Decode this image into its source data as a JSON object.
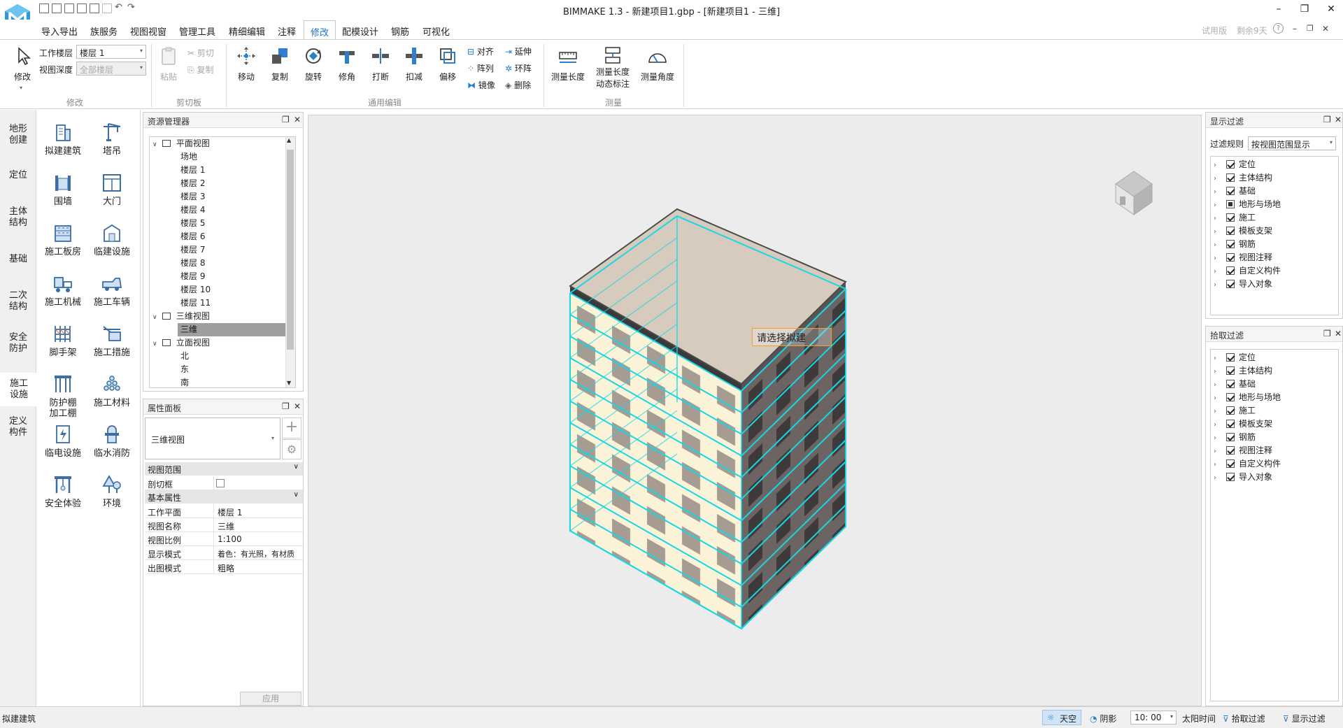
{
  "app": {
    "title": "BIMMAKE 1.3 - 新建项目1.gbp - [新建项目1 - 三维]"
  },
  "colors": {
    "accent": "#1e73c9",
    "selection_cyan": "#19d6e6",
    "panel_bg": "#f0f0f0",
    "viewport_bg": "#ececec"
  },
  "menu": {
    "items": [
      "导入导出",
      "族服务",
      "视图视窗",
      "管理工具",
      "精细编辑",
      "注释",
      "修改",
      "配模设计",
      "钢筋",
      "可视化"
    ],
    "active": "修改",
    "trial": "试用版",
    "remaining": "剩余9天",
    "help": "?"
  },
  "ribbon": {
    "modify": {
      "label": "修改",
      "group": "修改",
      "work_floor_label": "工作楼层",
      "work_floor_value": "楼层 1",
      "view_depth_label": "视图深度",
      "view_depth_value": "全部楼层"
    },
    "clipboard": {
      "group": "剪切板",
      "paste": "粘贴",
      "cut": "剪切",
      "copy": "复制"
    },
    "edit": {
      "group": "通用编辑",
      "move": "移动",
      "copy": "复制",
      "rotate": "旋转",
      "trim": "修角",
      "break": "打断",
      "deduct": "扣减",
      "offset": "偏移",
      "align": "对齐",
      "array": "阵列",
      "mirror": "镜像",
      "extend": "延伸",
      "ring_array": "环阵",
      "delete": "删除"
    },
    "measure": {
      "group": "测量",
      "length": "测量长度",
      "dynamic_line1": "测量长度",
      "dynamic_line2": "动态标注",
      "angle": "测量角度"
    }
  },
  "left_categories": [
    [
      "地形",
      "创建"
    ],
    [
      "定位"
    ],
    [
      "主体",
      "结构"
    ],
    [
      "基础"
    ],
    [
      "二次",
      "结构"
    ],
    [
      "安全",
      "防护"
    ],
    [
      "施工",
      "设施"
    ],
    [
      "定义",
      "构件"
    ]
  ],
  "tools": [
    [
      "拟建建筑"
    ],
    [
      "塔吊"
    ],
    [
      "围墙"
    ],
    [
      "大门"
    ],
    [
      "施工板房"
    ],
    [
      "临建设施"
    ],
    [
      "施工机械"
    ],
    [
      "施工车辆"
    ],
    [
      "脚手架"
    ],
    [
      "施工措施"
    ],
    [
      "防护棚",
      "加工棚"
    ],
    [
      "施工材料"
    ],
    [
      "临电设施"
    ],
    [
      "临水消防"
    ],
    [
      "安全体验"
    ],
    [
      "环境"
    ]
  ],
  "resource_manager": {
    "title": "资源管理器",
    "rows": [
      {
        "label": "平面视图",
        "level": 0,
        "expanded": true
      },
      {
        "label": "场地",
        "level": 1
      },
      {
        "label": "楼层 1",
        "level": 1
      },
      {
        "label": "楼层 2",
        "level": 1
      },
      {
        "label": "楼层 3",
        "level": 1
      },
      {
        "label": "楼层 4",
        "level": 1
      },
      {
        "label": "楼层 5",
        "level": 1
      },
      {
        "label": "楼层 6",
        "level": 1
      },
      {
        "label": "楼层 7",
        "level": 1
      },
      {
        "label": "楼层 8",
        "level": 1
      },
      {
        "label": "楼层 9",
        "level": 1
      },
      {
        "label": "楼层 10",
        "level": 1
      },
      {
        "label": "楼层 11",
        "level": 1
      },
      {
        "label": "三维视图",
        "level": 0,
        "expanded": true
      },
      {
        "label": "三维",
        "level": 1,
        "selected": true
      },
      {
        "label": "立面视图",
        "level": 0,
        "expanded": true
      },
      {
        "label": "北",
        "level": 1
      },
      {
        "label": "东",
        "level": 1
      },
      {
        "label": "南",
        "level": 1
      }
    ]
  },
  "properties": {
    "title": "属性面板",
    "type_value": "三维视图",
    "sections": {
      "view_range": "视图范围",
      "basic": "基本属性"
    },
    "clip_box": "剖切框",
    "rows": [
      {
        "k": "工作平面",
        "v": "楼层 1"
      },
      {
        "k": "视图名称",
        "v": "三维"
      },
      {
        "k": "视图比例",
        "v": "1:100"
      },
      {
        "k": "显示模式",
        "v": "着色：有光照，有材质"
      },
      {
        "k": "出图模式",
        "v": "粗略"
      }
    ],
    "apply": "应用"
  },
  "viewport": {
    "tooltip": "请选择拟建",
    "floors": 11
  },
  "display_filter": {
    "title": "显示过滤",
    "rule_label": "过滤规则",
    "rule_value": "按视图范围显示",
    "items": [
      {
        "label": "定位",
        "state": "on"
      },
      {
        "label": "主体结构",
        "state": "on"
      },
      {
        "label": "基础",
        "state": "on"
      },
      {
        "label": "地形与场地",
        "state": "partial"
      },
      {
        "label": "施工",
        "state": "on"
      },
      {
        "label": "模板支架",
        "state": "on"
      },
      {
        "label": "钢筋",
        "state": "on"
      },
      {
        "label": "视图注释",
        "state": "on"
      },
      {
        "label": "自定义构件",
        "state": "on"
      },
      {
        "label": "导入对象",
        "state": "on"
      }
    ]
  },
  "pick_filter": {
    "title": "拾取过滤",
    "items": [
      {
        "label": "定位",
        "state": "on"
      },
      {
        "label": "主体结构",
        "state": "on"
      },
      {
        "label": "基础",
        "state": "on"
      },
      {
        "label": "地形与场地",
        "state": "on"
      },
      {
        "label": "施工",
        "state": "on"
      },
      {
        "label": "模板支架",
        "state": "on"
      },
      {
        "label": "钢筋",
        "state": "on"
      },
      {
        "label": "视图注释",
        "state": "on"
      },
      {
        "label": "自定义构件",
        "state": "on"
      },
      {
        "label": "导入对象",
        "state": "on"
      }
    ]
  },
  "statusbar": {
    "left": "拟建建筑",
    "sky": "天空",
    "shadow": "阴影",
    "time": "10: 00",
    "sun_time": "太阳时间",
    "pick_filter": "拾取过滤",
    "display_filter": "显示过滤"
  }
}
